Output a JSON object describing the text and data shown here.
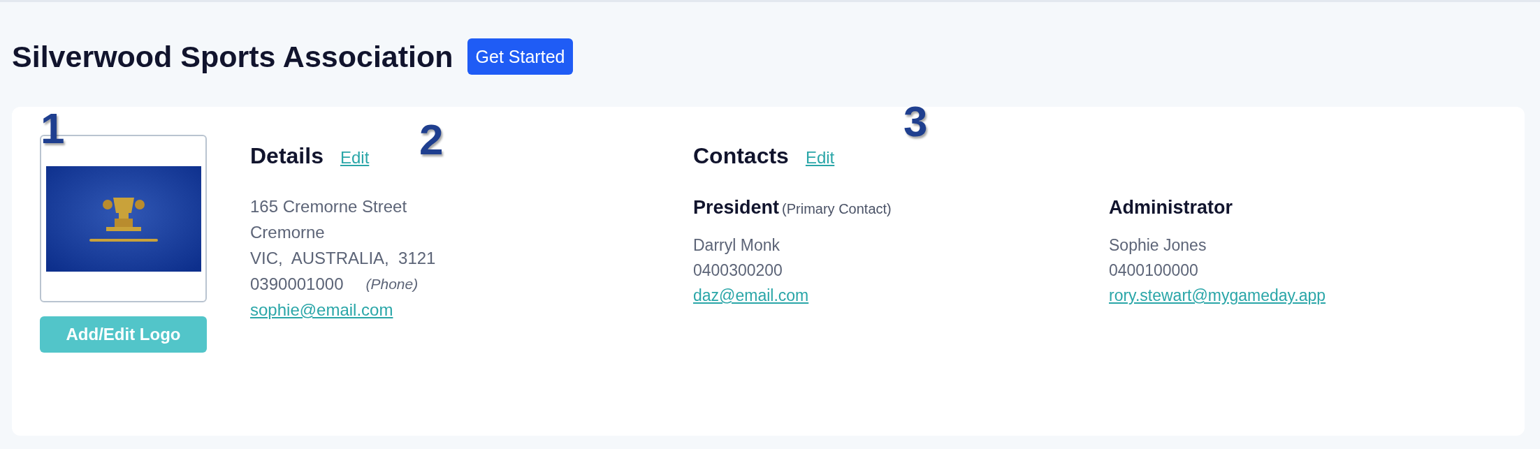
{
  "header": {
    "title": "Silverwood Sports Association",
    "button": "Get Started"
  },
  "logo": {
    "kind": "picture",
    "button": "Add/Edit Logo"
  },
  "details": {
    "title": "Details",
    "edit": "Edit",
    "lines": [
      "165 Cremorne Street",
      "Cremorne",
      "VIC,  AUSTRALIA,  3121"
    ],
    "phone": "0390001000",
    "phone_label": "(Phone)",
    "email": "sophie@email.com"
  },
  "contacts": {
    "title": "Contacts",
    "edit": "Edit",
    "people": [
      {
        "role": "President",
        "note": "(Primary Contact)",
        "name": "Darryl Monk",
        "phone": "0400300200",
        "email": "daz@email.com"
      },
      {
        "role": "Administrator",
        "name": "Sophie Jones",
        "phone": "0400100000",
        "email": "rory.stewart@mygameday.app"
      }
    ]
  },
  "callouts": [
    "1",
    "2",
    "3"
  ]
}
